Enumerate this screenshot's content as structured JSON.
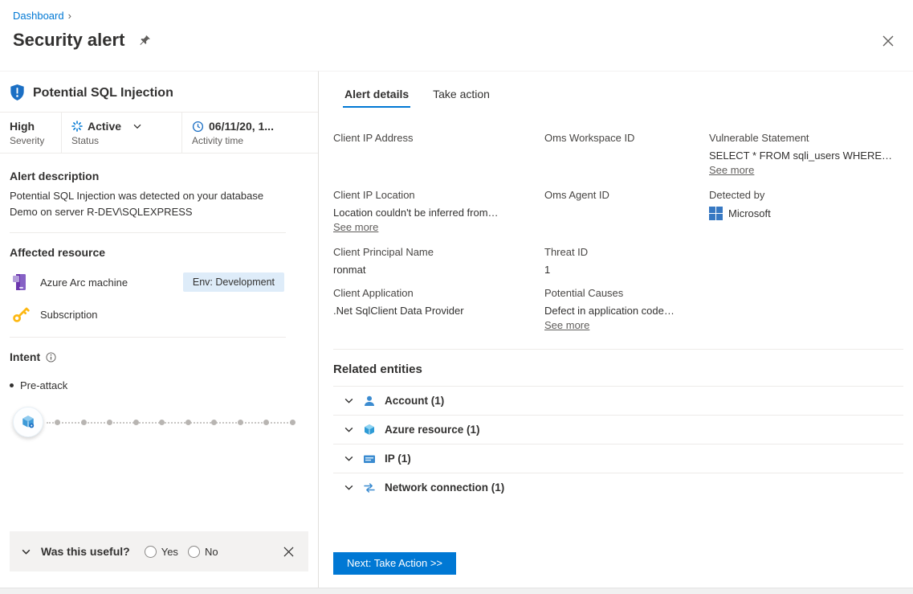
{
  "colors": {
    "accent": "#0078d4",
    "text": "#323130",
    "muted": "#605e5c",
    "border": "#edebe9",
    "badge_bg": "#deecf9",
    "feedback_bg": "#f3f2f1"
  },
  "breadcrumb": {
    "items": [
      {
        "label": "Dashboard"
      }
    ],
    "separator": "›"
  },
  "header": {
    "title": "Security alert"
  },
  "alert_panel": {
    "title": "Potential SQL Injection",
    "severity": {
      "value": "High",
      "label": "Severity"
    },
    "status": {
      "value": "Active",
      "label": "Status"
    },
    "activity": {
      "value": "06/11/20, 1...",
      "label": "Activity time"
    },
    "description": {
      "heading": "Alert description",
      "text": "Potential SQL Injection was detected on your database Demo on server R-DEV\\SQLEXPRESS"
    },
    "affected_resource": {
      "heading": "Affected resource",
      "resources": [
        {
          "name": "Azure Arc machine",
          "badge": "Env: Development",
          "icon": "azure-arc-machine-icon"
        },
        {
          "name": "Subscription",
          "icon": "key-icon"
        }
      ]
    },
    "intent": {
      "heading": "Intent",
      "stage": "Pre-attack",
      "kill_chain_steps": 10
    }
  },
  "feedback": {
    "question": "Was this useful?",
    "options": [
      {
        "label": "Yes"
      },
      {
        "label": "No"
      }
    ]
  },
  "tabs": [
    {
      "label": "Alert details",
      "active": true
    },
    {
      "label": "Take action",
      "active": false
    }
  ],
  "details": {
    "client_ip_address": {
      "label": "Client IP Address"
    },
    "oms_workspace_id": {
      "label": "Oms Workspace ID"
    },
    "vulnerable_statement": {
      "label": "Vulnerable Statement",
      "value": "SELECT * FROM sqli_users WHERE…",
      "link": "See more"
    },
    "client_ip_location": {
      "label": "Client IP Location",
      "value": "Location couldn't be inferred from…",
      "link": "See more"
    },
    "oms_agent_id": {
      "label": "Oms Agent ID"
    },
    "detected_by": {
      "label": "Detected by",
      "value": "Microsoft"
    },
    "client_principal_name": {
      "label": "Client Principal Name",
      "value": "ronmat"
    },
    "threat_id": {
      "label": "Threat ID",
      "value": "1"
    },
    "client_application": {
      "label": "Client Application",
      "value": ".Net SqlClient Data Provider"
    },
    "potential_causes": {
      "label": "Potential Causes",
      "value": "Defect in application code…",
      "link": "See more"
    }
  },
  "related_entities": {
    "heading": "Related entities",
    "items": [
      {
        "label": "Account (1)",
        "icon": "account-icon"
      },
      {
        "label": "Azure resource (1)",
        "icon": "azure-resource-icon"
      },
      {
        "label": "IP (1)",
        "icon": "ip-icon"
      },
      {
        "label": "Network connection (1)",
        "icon": "network-connection-icon"
      }
    ]
  },
  "footer": {
    "next_button": "Next: Take Action >>"
  }
}
